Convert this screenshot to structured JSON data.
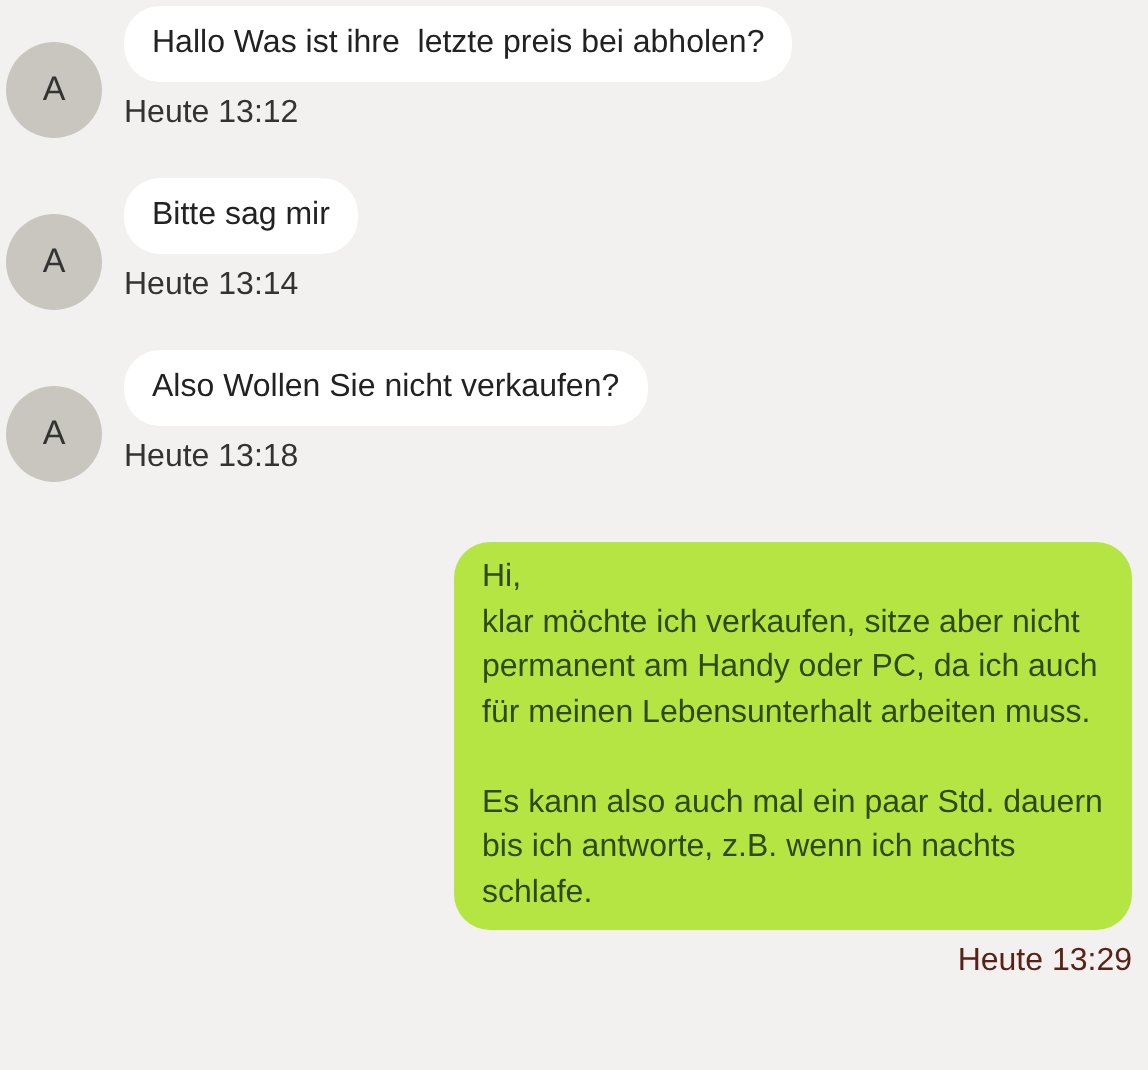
{
  "messages": [
    {
      "kind": "incoming",
      "avatar": "A",
      "text": "Hallo Was ist ihre  letzte preis bei abholen?",
      "time": "Heute 13:12"
    },
    {
      "kind": "incoming",
      "avatar": "A",
      "text": "Bitte sag mir",
      "time": "Heute 13:14"
    },
    {
      "kind": "incoming",
      "avatar": "A",
      "text": "Also Wollen Sie nicht verkaufen?",
      "time": "Heute 13:18"
    },
    {
      "kind": "outgoing",
      "text": "Hi,\nklar möchte ich verkaufen, sitze aber nicht permanent am Handy oder PC, da ich auch für meinen Lebensunterhalt arbeiten muss.\n\nEs kann also auch mal ein paar Std. dauern bis ich antworte, z.B. wenn ich nachts schlafe.",
      "time": "Heute 13:29"
    }
  ]
}
